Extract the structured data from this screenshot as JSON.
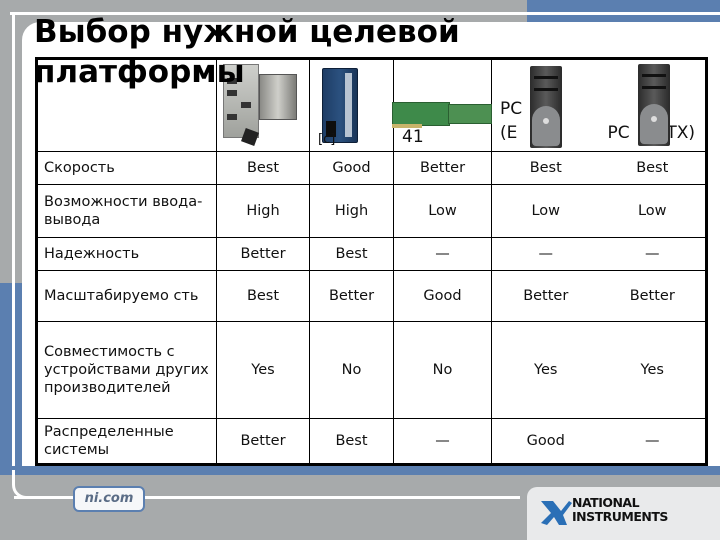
{
  "slide": {
    "title": "Выбор нужной целевой платформы",
    "footer_link": "ni.com",
    "brand": {
      "line1": "NATIONAL",
      "line2": "INSTRUMENTS",
      "accent_color": "#5b7fb0",
      "mark_color": "#2a6fb6"
    }
  },
  "table": {
    "columns": [
      {
        "label": "",
        "image": "pxi-controller-image"
      },
      {
        "label": "[c]",
        "image": "crio-module-image"
      },
      {
        "label": "41",
        "image": "pci-card-image"
      },
      {
        "label_line1": "PC",
        "label_line2": "(E",
        "image": "desktop-tower-image"
      },
      {
        "label": "PC (   TX)",
        "label_left": "PC",
        "label_right": "TX)",
        "image": "desktop-tower-image"
      }
    ],
    "rows": [
      {
        "label": "Скорость",
        "values": [
          "Best",
          "Good",
          "Better",
          "Best",
          "Best"
        ]
      },
      {
        "label": "Возможности ввода-вывода",
        "values": [
          "High",
          "High",
          "Low",
          "Low",
          "Low"
        ]
      },
      {
        "label": "Надежность",
        "values": [
          "Better",
          "Best",
          "—",
          "—",
          "—"
        ]
      },
      {
        "label": "Масштабируемо сть",
        "values": [
          "Best",
          "Better",
          "Good",
          "Better",
          "Better"
        ]
      },
      {
        "label": "Совместимость с устройствами других производителей",
        "values": [
          "Yes",
          "No",
          "No",
          "Yes",
          "Yes"
        ]
      },
      {
        "label": "Распределенные системы",
        "values": [
          "Better",
          "Best",
          "—",
          "Good",
          "—"
        ]
      }
    ]
  }
}
